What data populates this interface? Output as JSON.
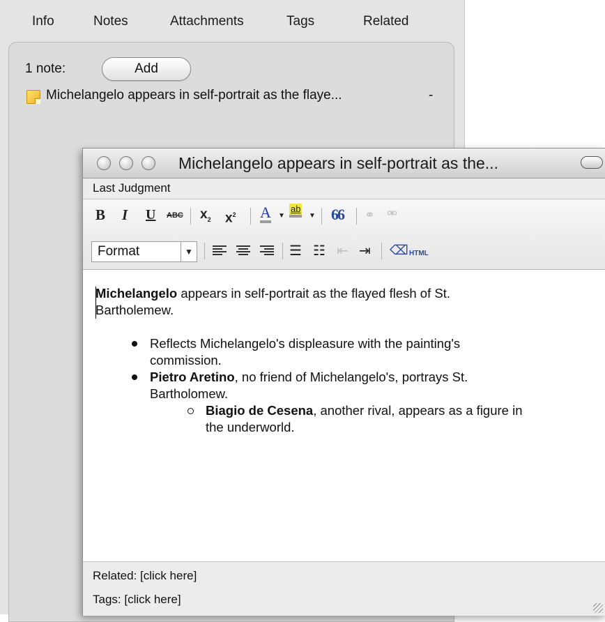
{
  "tabs": [
    {
      "label": "Info"
    },
    {
      "label": "Notes"
    },
    {
      "label": "Attachments"
    },
    {
      "label": "Tags"
    },
    {
      "label": "Related"
    }
  ],
  "notes_pane": {
    "count_label": "1 note:",
    "add_label": "Add",
    "items": [
      {
        "title": "Michelangelo appears in self-portrait as the flaye...",
        "remove": "-"
      }
    ]
  },
  "note_window": {
    "title": "Michelangelo appears in self-portrait as the...",
    "parent_item": "Last Judgment",
    "toolbar": {
      "bold": "B",
      "italic": "I",
      "underline": "U",
      "strikethrough": "ABC",
      "subscript": "x",
      "superscript": "x",
      "text_color": "A",
      "highlight": "ab",
      "blockquote": "66",
      "format_select": "Format",
      "html": "HTML"
    },
    "body": {
      "para_bold": "Michelangelo",
      "para_rest": " appears in self-portrait as the flayed flesh of St.",
      "para_line2": "Bartholemew.",
      "bullet1_line1": "Reflects Michelangelo's displeasure with the painting's",
      "bullet1_line2": "commission.",
      "bullet2_bold": "Pietro Aretino",
      "bullet2_rest": ", no friend of Michelangelo's, portrays St.",
      "bullet2_line2": "Bartholomew.",
      "sub1_bold": "Biagio de Cesena",
      "sub1_rest": ", another rival, appears as a figure in",
      "sub1_line2": "the underworld."
    },
    "footer": {
      "related": "Related: [click here]",
      "tags": "Tags: [click here]"
    }
  },
  "colors": {
    "pane_background": "#e4e4e4",
    "highlight_yellow": "#f2e640",
    "text_color_underline": "#2a5bd7"
  }
}
